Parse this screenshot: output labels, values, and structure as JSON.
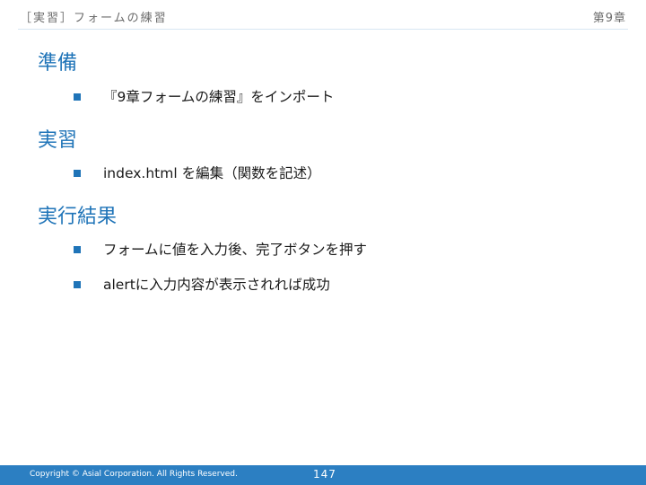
{
  "header": {
    "title": "［実習］フォームの練習",
    "chapter": "第9章"
  },
  "colors": {
    "accent": "#1f74b8",
    "footer_bg": "#2c7fc2",
    "header_text": "#6b6b6b"
  },
  "sections": [
    {
      "title": "準備",
      "bullets": [
        "『9章フォームの練習』をインポート"
      ]
    },
    {
      "title": "実習",
      "bullets": [
        "index.html を編集（関数を記述）"
      ]
    },
    {
      "title": "実行結果",
      "bullets": [
        "フォームに値を入力後、完了ボタンを押す",
        "alertに入力内容が表示されれば成功"
      ]
    }
  ],
  "bullet_icon": "square-bullet-icon",
  "footer": {
    "copyright": "Copyright © Asial Corporation. All Rights Reserved.",
    "page_number": "147"
  }
}
